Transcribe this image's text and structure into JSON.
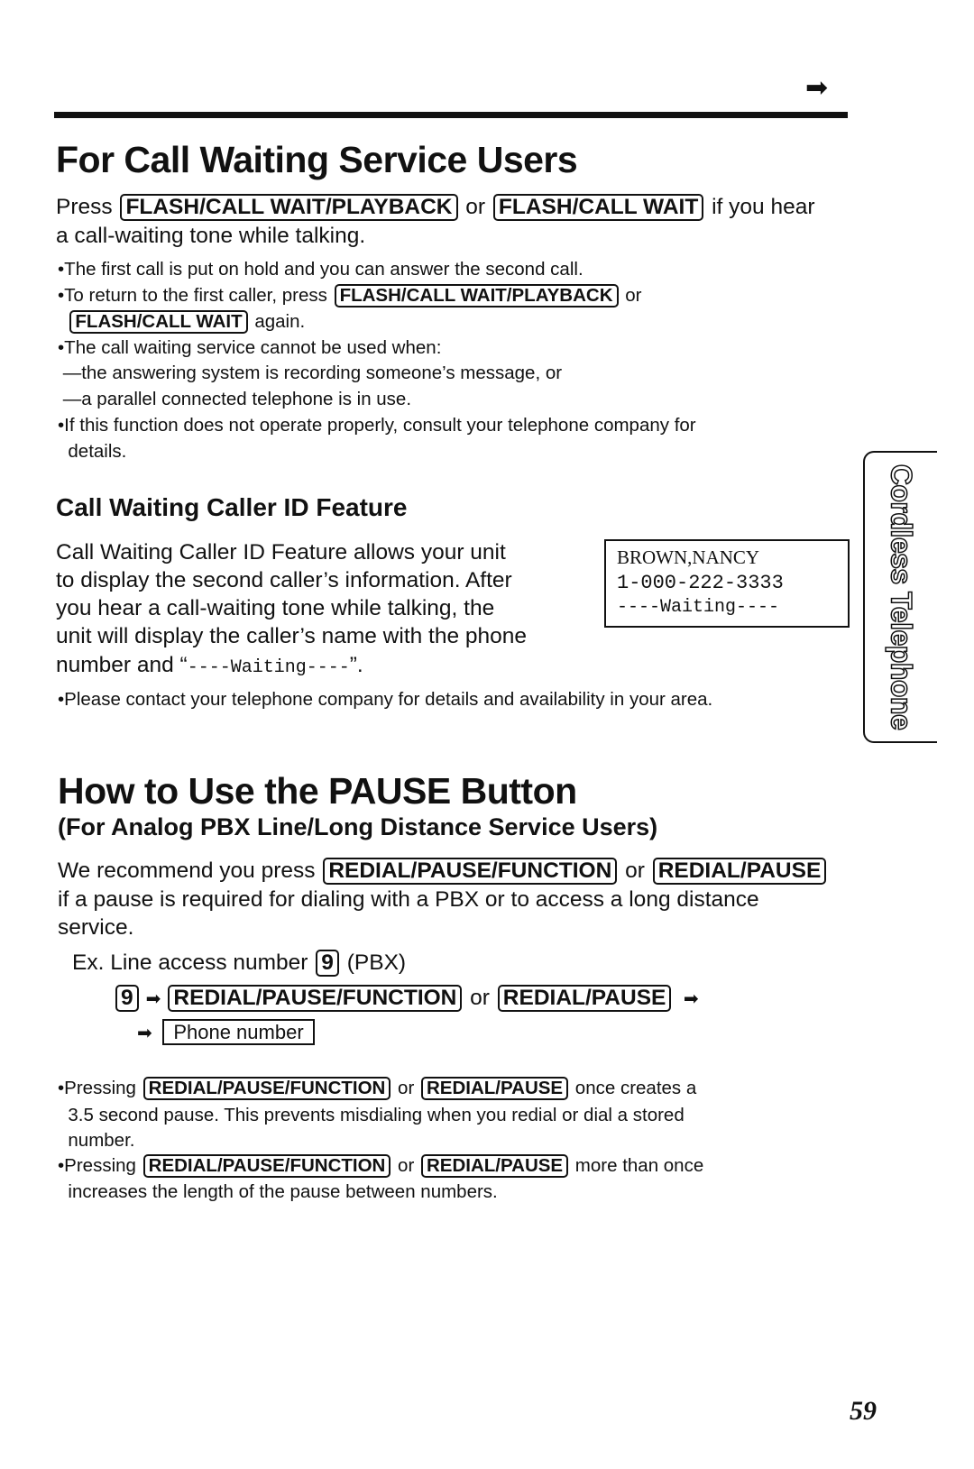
{
  "continue_icon": "arrow-right-icon",
  "section1": {
    "title": "For Call Waiting Service Users",
    "intro": [
      [
        {
          "t": "Press "
        },
        {
          "k": "FLASH/CALL WAIT/PLAYBACK"
        },
        {
          "t": " or "
        },
        {
          "k": "FLASH/CALL WAIT"
        },
        {
          "t": " if you hear"
        }
      ],
      [
        {
          "t": "a call-waiting tone while talking."
        }
      ]
    ],
    "notes": [
      [
        {
          "t": "•The first call is put on hold and you can answer the second call."
        }
      ],
      [
        {
          "t": "•To return to the first caller, press "
        },
        {
          "k": "FLASH/CALL WAIT/PLAYBACK"
        },
        {
          "t": " or"
        }
      ],
      [
        {
          "t": "  "
        },
        {
          "k": "FLASH/CALL WAIT"
        },
        {
          "t": " again."
        }
      ],
      [
        {
          "t": "•The call waiting service cannot be used when:"
        }
      ],
      [
        {
          "t": " —the answering system is recording someone’s message, or"
        }
      ],
      [
        {
          "t": " —a parallel connected telephone is in use."
        }
      ],
      [
        {
          "t": "•If this function does not operate properly, consult your telephone company for"
        }
      ],
      [
        {
          "t": "  details."
        }
      ]
    ],
    "subheading": "Call Waiting Caller ID Feature",
    "para": [
      [
        {
          "t": "Call Waiting Caller ID Feature allows your unit"
        }
      ],
      [
        {
          "t": "to display the second caller’s information. After"
        }
      ],
      [
        {
          "t": "you hear a call-waiting tone while talking, the"
        }
      ],
      [
        {
          "t": "unit will display the caller’s name with the phone"
        }
      ],
      [
        {
          "t": "number and “"
        },
        {
          "m": "----Waiting----"
        },
        {
          "t": "”."
        }
      ]
    ],
    "display": [
      "BROWN,NANCY",
      "1-000-222-3333",
      "----Waiting----"
    ],
    "note2": [
      {
        "t": "•Please contact your telephone company for details and availability in your area."
      }
    ]
  },
  "side_tab": "Cordless Telephone",
  "section2": {
    "title": "How to Use the PAUSE Button",
    "subtitle": "(For Analog PBX Line/Long Distance Service Users)",
    "intro": [
      [
        {
          "t": "We recommend you press "
        },
        {
          "k": "REDIAL/PAUSE/FUNCTION"
        },
        {
          "t": " or "
        },
        {
          "k": "REDIAL/PAUSE"
        }
      ],
      [
        {
          "t": "if a pause is required for dialing with a PBX or to access a long distance"
        }
      ],
      [
        {
          "t": "service."
        }
      ]
    ],
    "example": [
      [
        {
          "t": "Ex. Line access number "
        },
        {
          "k": "9"
        },
        {
          "t": " (PBX)"
        }
      ],
      [
        {
          "k": "9"
        },
        {
          "a": "➡"
        },
        {
          "k": "REDIAL/PAUSE/FUNCTION"
        },
        {
          "t": " or "
        },
        {
          "k": "REDIAL/PAUSE"
        },
        {
          "a": " ➡"
        }
      ],
      [
        {
          "a": "➡ "
        },
        {
          "b": "Phone number"
        }
      ]
    ],
    "notes": [
      [
        {
          "t": "•Pressing "
        },
        {
          "k": "REDIAL/PAUSE/FUNCTION"
        },
        {
          "t": " or "
        },
        {
          "k": "REDIAL/PAUSE"
        },
        {
          "t": " once creates a"
        }
      ],
      [
        {
          "t": "  3.5 second pause. This prevents misdialing when you redial or dial a stored"
        }
      ],
      [
        {
          "t": "  number."
        }
      ],
      [
        {
          "t": "•Pressing "
        },
        {
          "k": "REDIAL/PAUSE/FUNCTION"
        },
        {
          "t": " or "
        },
        {
          "k": "REDIAL/PAUSE"
        },
        {
          "t": " more than once"
        }
      ],
      [
        {
          "t": "  increases the length of the pause between numbers."
        }
      ]
    ]
  },
  "page_number": "59"
}
